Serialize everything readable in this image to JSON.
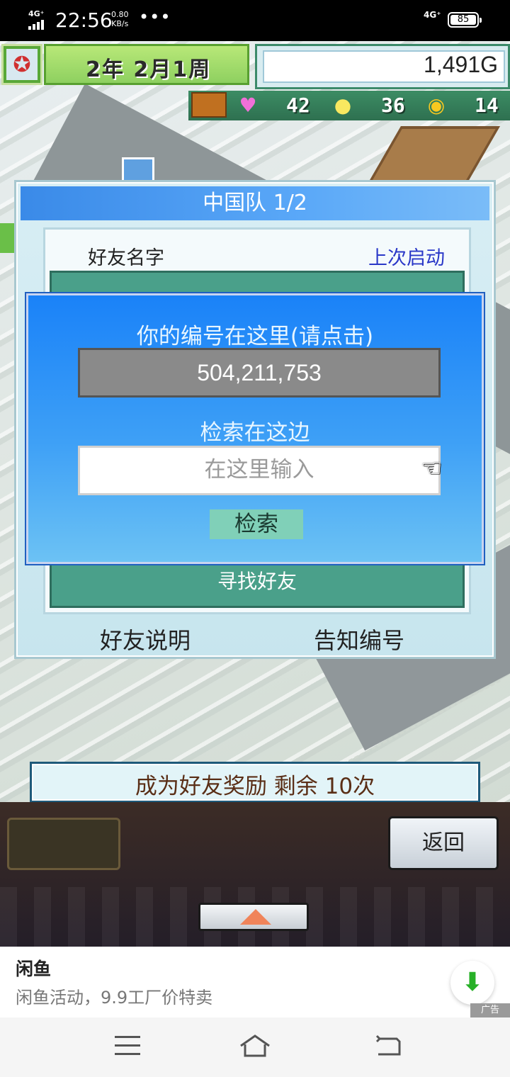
{
  "status_bar": {
    "network_left": "4G⁺",
    "time": "22:56",
    "speed_value": "0.80",
    "speed_unit": "KB/s",
    "dots": "•••",
    "network_right": "4G⁺",
    "battery": "85"
  },
  "hud": {
    "date": "2年 2月1周",
    "gold": "1,491G",
    "stats": [
      {
        "icon": "heart-icon",
        "value": "42"
      },
      {
        "icon": "lightbulb-icon",
        "value": "36"
      },
      {
        "icon": "coin-icon",
        "value": "14"
      }
    ]
  },
  "dialog": {
    "title": "中国队 1/2",
    "col_name": "好友名字",
    "col_last": "上次启动",
    "find_friend": "寻找好友",
    "btn_explain": "好友说明",
    "btn_notify": "告知编号"
  },
  "search": {
    "title": "你的编号在这里(请点击)",
    "my_id": "504,211,753",
    "label": "检索在这边",
    "input_placeholder": "在这里输入",
    "button": "检索"
  },
  "reward": {
    "text": "成为好友奖励 剩余 10次"
  },
  "gamebar": {
    "back": "返回"
  },
  "ad": {
    "title": "闲鱼",
    "subtitle": "闲鱼活动，9.9工厂价特卖",
    "tag": "广告"
  },
  "colors": {
    "dialog_title_bg": "#3a8ae8",
    "search_bg": "#1a82f8",
    "friend_list_bg": "#4aa08a",
    "link_blue": "#2a38c8",
    "reward_text": "#5a2e16"
  }
}
